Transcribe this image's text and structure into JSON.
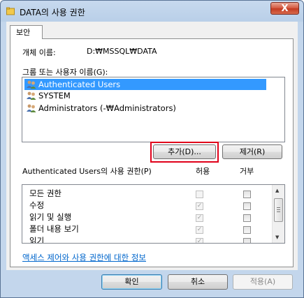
{
  "window": {
    "title": "DATA의 사용 권한",
    "close_label": "X"
  },
  "tab": {
    "label": "보안"
  },
  "object": {
    "label": "개체 이름:",
    "value": "D:₩MSSQL₩DATA"
  },
  "groups": {
    "label": "그룹 또는 사용자 이름(G):",
    "items": [
      {
        "name": "Authenticated Users",
        "selected": true
      },
      {
        "name": "SYSTEM",
        "selected": false
      },
      {
        "name": "Administrators (-₩Administrators)",
        "selected": false
      }
    ]
  },
  "buttons": {
    "add": "추가(D)...",
    "remove": "제거(R)"
  },
  "permissions": {
    "label": "Authenticated Users의 사용 권한(P)",
    "allow_header": "허용",
    "deny_header": "거부",
    "rows": [
      {
        "name": "모든 권한",
        "allow": false,
        "deny": false
      },
      {
        "name": "수정",
        "allow": true,
        "deny": false
      },
      {
        "name": "읽기 및 실행",
        "allow": true,
        "deny": false
      },
      {
        "name": "폴더 내용 보기",
        "allow": true,
        "deny": false
      },
      {
        "name": "읽기",
        "allow": true,
        "deny": false
      }
    ]
  },
  "link": {
    "label": "액세스 제어와 사용 권한에 대한 정보"
  },
  "footer": {
    "ok": "확인",
    "cancel": "취소",
    "apply": "적용(A)"
  }
}
